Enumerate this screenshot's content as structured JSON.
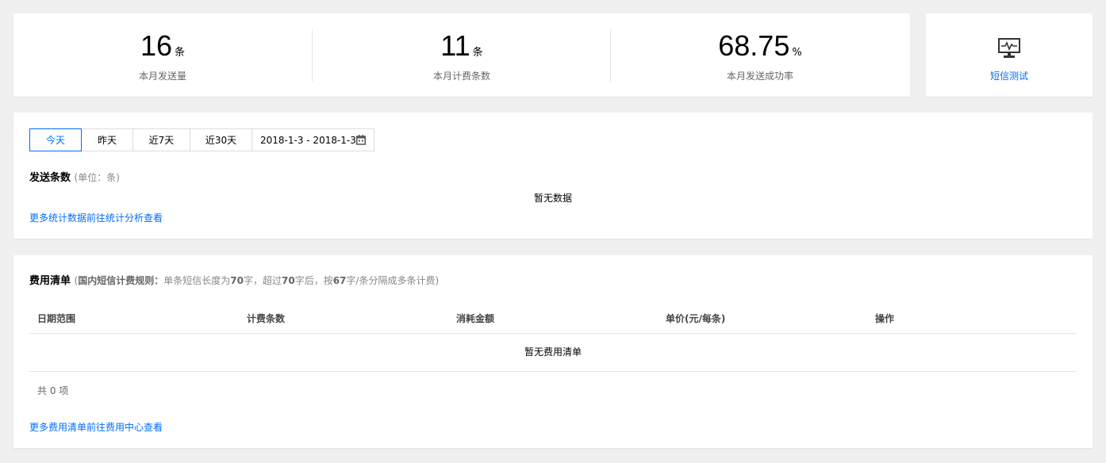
{
  "stats": [
    {
      "value": "16",
      "unit": "条",
      "label": "本月发送量"
    },
    {
      "value": "11",
      "unit": "条",
      "label": "本月计费条数"
    },
    {
      "value": "68.75",
      "unit": "%",
      "label": "本月发送成功率"
    }
  ],
  "sms_test": {
    "label": "短信测试",
    "icon": "monitor-pulse-icon"
  },
  "send": {
    "filters": [
      "今天",
      "昨天",
      "近7天",
      "近30天"
    ],
    "active_filter": "今天",
    "date_range": "2018-1-3 - 2018-1-3",
    "title": "发送条数",
    "unit_note": "(单位：条)",
    "empty_text": "暂无数据",
    "more_link": "更多统计数据前往统计分析查看"
  },
  "billing": {
    "title": "费用清单",
    "rule_open": "(",
    "rule_label": "国内短信计费规则：",
    "rule_p1": "单条短信长度为",
    "rule_n1": "70",
    "rule_p2": "字，超过",
    "rule_n2": "70",
    "rule_p3": "字后，按",
    "rule_n3": "67",
    "rule_p4": "字/条分隔成多条计费)",
    "columns": [
      "日期范围",
      "计费条数",
      "消耗金额",
      "单价(元/每条)",
      "操作"
    ],
    "empty_text": "暂无费用清单",
    "total": "共 0 项",
    "more_link": "更多费用清单前往费用中心查看"
  },
  "colors": {
    "accent": "#006eff",
    "background": "#f0f0f0"
  }
}
